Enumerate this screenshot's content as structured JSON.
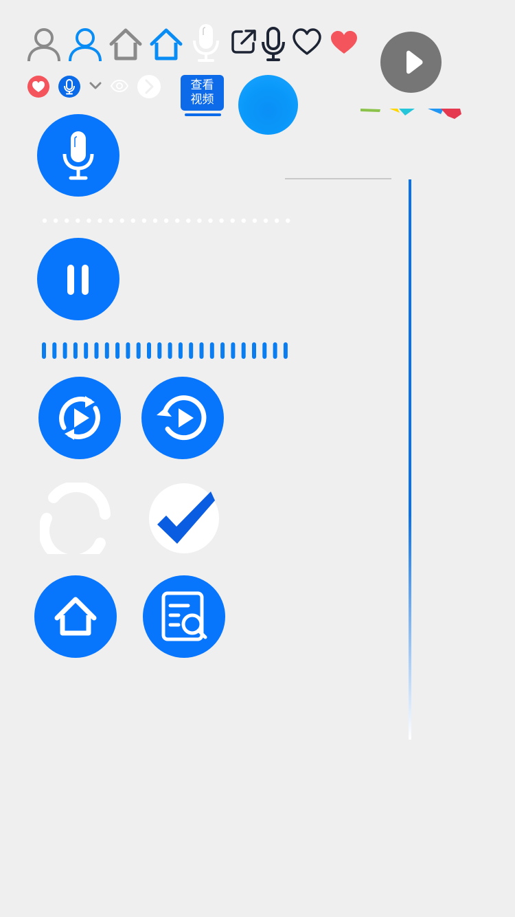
{
  "badge": {
    "line1": "查看",
    "line2": "视频"
  },
  "colors": {
    "primary_blue": "#0776fd",
    "badge_blue": "#0d6ae8",
    "heart_red": "#f4545b",
    "icon_gray": "#8a8a8a",
    "icon_dark": "#1d2433",
    "gray_circle": "#767676",
    "background": "#efefef"
  },
  "icons": {
    "row1": [
      "user-gray-icon",
      "user-blue-icon",
      "home-gray-icon",
      "home-blue-icon",
      "microphone-white-icon",
      "external-link-icon",
      "microphone-dark-icon",
      "heart-outline-icon",
      "heart-filled-icon"
    ],
    "row2": [
      "heart-badge-icon",
      "microphone-badge-icon",
      "chevron-down-icon",
      "eye-icon",
      "chevron-right-icon"
    ],
    "large": [
      "microphone-icon",
      "pause-icon",
      "replay-icon",
      "replay-left-icon",
      "loading-ring-icon",
      "checkmark-icon",
      "home-icon",
      "document-search-icon"
    ]
  }
}
